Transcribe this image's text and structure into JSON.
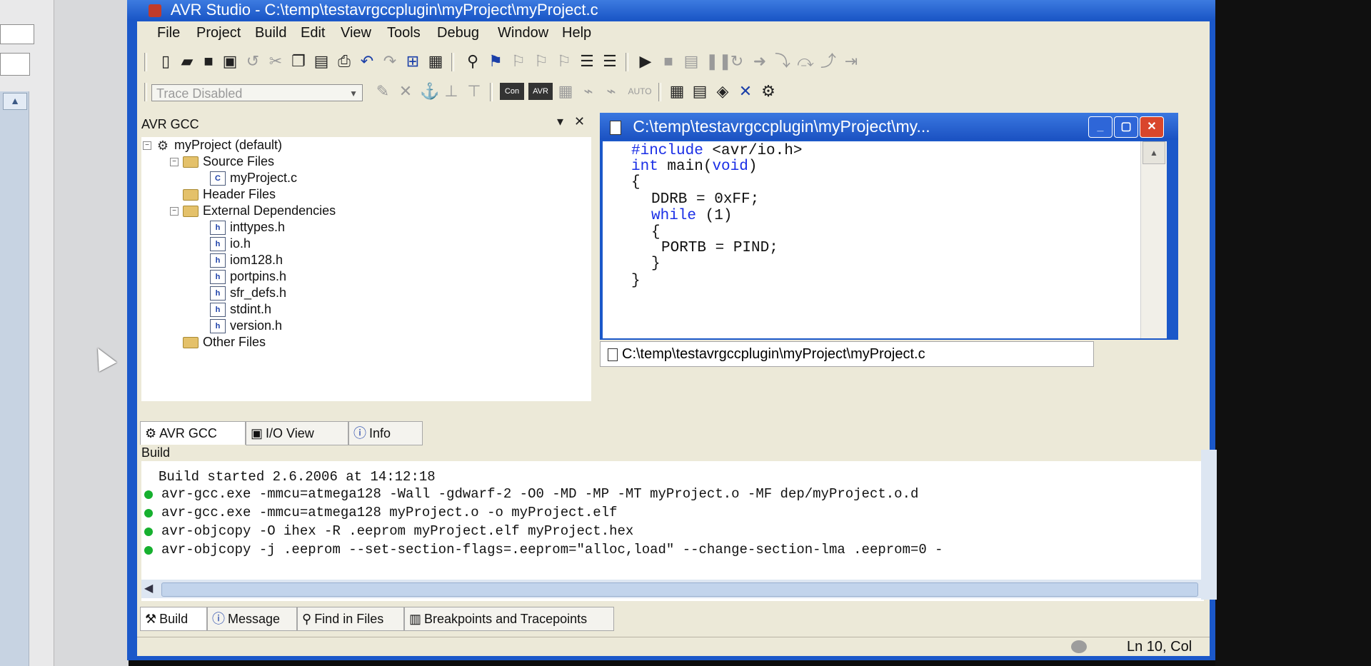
{
  "window": {
    "title": "AVR Studio - C:\\temp\\testavrgccplugin\\myProject\\myProject.c"
  },
  "menu": [
    "File",
    "Project",
    "Build",
    "Edit",
    "View",
    "Tools",
    "Debug",
    "Window",
    "Help"
  ],
  "toolbar": {
    "trace_select_value": "Trace Disabled",
    "con_label": "Con",
    "avr_label": "AVR",
    "auto_label": "AUTO"
  },
  "project_panel": {
    "title": "AVR GCC",
    "tree": {
      "root": "myProject (default)",
      "source_files": "Source Files",
      "source_items": [
        "myProject.c"
      ],
      "header_files": "Header Files",
      "external_dependencies": "External Dependencies",
      "dependency_items": [
        "inttypes.h",
        "io.h",
        "iom128.h",
        "portpins.h",
        "sfr_defs.h",
        "stdint.h",
        "version.h"
      ],
      "other_files": "Other Files"
    },
    "tabs": [
      "AVR GCC",
      "I/O View",
      "Info"
    ]
  },
  "editor": {
    "title": "C:\\temp\\testavrgccplugin\\myProject\\my...",
    "tab_label": "C:\\temp\\testavrgccplugin\\myProject\\myProject.c",
    "code": {
      "l1_kw": "#include",
      "l1_rest": " <avr/io.h>",
      "l2_kw1": "int",
      "l2_mid": " main(",
      "l2_kw2": "void",
      "l2_end": ")",
      "l3": "{",
      "l4": "DDRB = 0xFF;",
      "l5_kw": "while",
      "l5_rest": " (1)",
      "l6": "{",
      "l7": "PORTB = PIND;",
      "l8": "}",
      "l9": "}"
    }
  },
  "build": {
    "label": "Build",
    "started": "Build started 2.6.2006 at 14:12:18",
    "lines": [
      "avr-gcc.exe  -mmcu=atmega128 -Wall -gdwarf-2 -O0 -MD -MP -MT myProject.o -MF dep/myProject.o.d",
      "avr-gcc.exe -mmcu=atmega128  myProject.o     -o myProject.elf",
      "avr-objcopy -O ihex -R .eeprom  myProject.elf myProject.hex",
      "avr-objcopy -j .eeprom --set-section-flags=.eeprom=\"alloc,load\" --change-section-lma .eeprom=0 -"
    ],
    "tabs": [
      "Build",
      "Message",
      "Find in Files",
      "Breakpoints and Tracepoints"
    ]
  },
  "status": {
    "position": "Ln 10, Col"
  }
}
